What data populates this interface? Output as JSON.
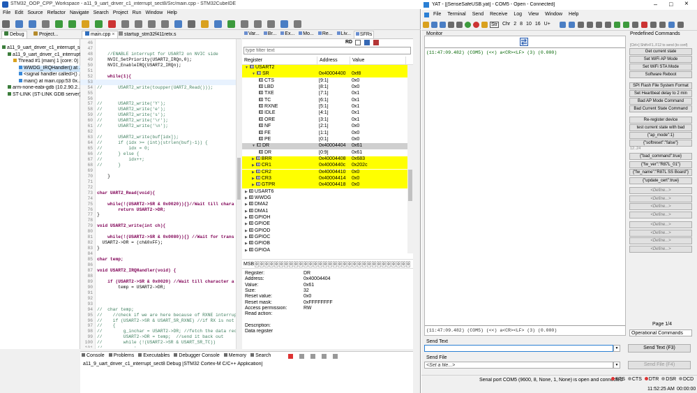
{
  "ide": {
    "title": "STM32_OOP_CPP_Workspace - a11_9_uart_driver_c1_interrupt_sect8/Src/main.cpp - STM32CubeIDE",
    "menu": [
      "File",
      "Edit",
      "Source",
      "Refactor",
      "Navigate",
      "Search",
      "Project",
      "Run",
      "Window",
      "Help"
    ],
    "debug_view": {
      "tab_debug": "Debug",
      "tab_project": "Project...",
      "tree": [
        {
          "text": "a11_9_uart_driver_c1_interrupt_sect8",
          "indent": 0
        },
        {
          "text": "a11_9_uart_driver_c1_interrupt_...",
          "indent": 1
        },
        {
          "text": "Thread #1 [main] 1 [core: 0]",
          "indent": 2
        },
        {
          "text": "WWDG_IRQHandler() at ...",
          "indent": 3
        },
        {
          "text": "<signal handler called>() ...",
          "indent": 3
        },
        {
          "text": "main() at main.cpp:53 0x...",
          "indent": 3
        },
        {
          "text": "arm-none-eabi-gdb (10.2.90.2...",
          "indent": 1
        },
        {
          "text": "ST-LINK (ST-LINK GDB server)",
          "indent": 1
        }
      ]
    },
    "editor": {
      "tab_main": "main.cpp",
      "tab_startup": "startup_stm32f411retx.s",
      "lines": [
        {
          "n": "46",
          "code": ""
        },
        {
          "n": "47",
          "code": ""
        },
        {
          "n": "48",
          "code": "    //ENABLE interrupt for USART2 on NVIC side"
        },
        {
          "n": "49",
          "code": "    NVIC_SetPriority(USART2_IRQn,0);"
        },
        {
          "n": "50",
          "code": "    NVIC_EnableIRQ(USART2_IRQn);"
        },
        {
          "n": "51",
          "code": ""
        },
        {
          "n": "52",
          "code": "    while(1){"
        },
        {
          "n": "53",
          "code": ""
        },
        {
          "n": "54",
          "code": "//      USART2_write(toupper(UART2_Read()));"
        },
        {
          "n": "55",
          "code": ""
        },
        {
          "n": "56",
          "code": ""
        },
        {
          "n": "57",
          "code": "//      USART2_write('Y');"
        },
        {
          "n": "58",
          "code": "//      USART2_write('e');"
        },
        {
          "n": "59",
          "code": "//      USART2_write('s');"
        },
        {
          "n": "60",
          "code": "//      USART2_write('\\r');"
        },
        {
          "n": "61",
          "code": "//      USART2_write('\\n');"
        },
        {
          "n": "62",
          "code": ""
        },
        {
          "n": "63",
          "code": "//      USART2_write(buf[idx]);"
        },
        {
          "n": "64",
          "code": "//      if (idx >= (int)(strlen(buf)-1)) {"
        },
        {
          "n": "65",
          "code": "//          idx = 0;"
        },
        {
          "n": "66",
          "code": "//      } else {"
        },
        {
          "n": "67",
          "code": "//          idx++;"
        },
        {
          "n": "68",
          "code": "//      }"
        },
        {
          "n": "69",
          "code": ""
        },
        {
          "n": "70",
          "code": "    }"
        },
        {
          "n": "71",
          "code": ""
        },
        {
          "n": "72",
          "code": ""
        },
        {
          "n": "73",
          "code": "char UART2_Read(void){"
        },
        {
          "n": "74",
          "code": ""
        },
        {
          "n": "75",
          "code": "    while(!(USART2->SR & 0x0020)){}//Wait till chara"
        },
        {
          "n": "76",
          "code": "        return USART2->DR;"
        },
        {
          "n": "77",
          "code": "}"
        },
        {
          "n": "78",
          "code": ""
        },
        {
          "n": "79",
          "code": "void USART2_write(int ch){"
        },
        {
          "n": "80",
          "code": ""
        },
        {
          "n": "81",
          "code": "    while(!(USART2->SR & 0x0080)){} //Wait for trans"
        },
        {
          "n": "82",
          "code": "  USART2->DR = (ch&0xFF);"
        },
        {
          "n": "83",
          "code": "}"
        },
        {
          "n": "84",
          "code": ""
        },
        {
          "n": "85",
          "code": "char temp;"
        },
        {
          "n": "86",
          "code": ""
        },
        {
          "n": "87",
          "code": "void USART2_IRQHandler(void) {"
        },
        {
          "n": "88",
          "code": ""
        },
        {
          "n": "89",
          "code": "    if (USART2->SR & 0x0020) //Wait till character a"
        },
        {
          "n": "90",
          "code": "        temp = USART2->DR;"
        },
        {
          "n": "91",
          "code": ""
        },
        {
          "n": "92",
          "code": ""
        },
        {
          "n": "93",
          "code": ""
        },
        {
          "n": "94",
          "code": "//  char temp;"
        },
        {
          "n": "95",
          "code": "//    //check if we are here because of RXNE interrup"
        },
        {
          "n": "96",
          "code": "//    if (USART2->SR & USART_SR_RXNE) //if RX is not"
        },
        {
          "n": "97",
          "code": "//    {"
        },
        {
          "n": "98",
          "code": "//        g_inchar = USART2->DR; //fetch the data rec"
        },
        {
          "n": "99",
          "code": "//        USART2->DR = temp;  //send it back out"
        },
        {
          "n": "100",
          "code": "//        while (!(USART2->SR & USART_SR_TC))"
        },
        {
          "n": "101",
          "code": "//            ;"
        },
        {
          "n": "102",
          "code": ""
        }
      ]
    },
    "sfr": {
      "tabs": [
        "Var...",
        "Br...",
        "Ex...",
        "Mo...",
        "Re...",
        "Liv...",
        "SFRs"
      ],
      "filter_placeholder": "type filter text",
      "rd_label": "RD",
      "col_register": "Register",
      "col_address": "Address",
      "col_value": "Value",
      "rows": [
        {
          "name": "USART2",
          "addr": "",
          "val": "",
          "indent": 0,
          "hl": true
        },
        {
          "name": "SR",
          "addr": "0x40004400",
          "val": "0xf8",
          "indent": 1,
          "hl": true
        },
        {
          "name": "CTS",
          "addr": "[9:1]",
          "val": "0x0",
          "indent": 2,
          "hl": false
        },
        {
          "name": "LBD",
          "addr": "[8:1]",
          "val": "0x0",
          "indent": 2,
          "hl": false
        },
        {
          "name": "TXE",
          "addr": "[7:1]",
          "val": "0x1",
          "indent": 2,
          "hl": false
        },
        {
          "name": "TC",
          "addr": "[6:1]",
          "val": "0x1",
          "indent": 2,
          "hl": false
        },
        {
          "name": "RXNE",
          "addr": "[5:1]",
          "val": "0x1",
          "indent": 2,
          "hl": false
        },
        {
          "name": "IDLE",
          "addr": "[4:1]",
          "val": "0x1",
          "indent": 2,
          "hl": false
        },
        {
          "name": "ORE",
          "addr": "[3:1]",
          "val": "0x1",
          "indent": 2,
          "hl": false
        },
        {
          "name": "NF",
          "addr": "[2:1]",
          "val": "0x0",
          "indent": 2,
          "hl": false
        },
        {
          "name": "FE",
          "addr": "[1:1]",
          "val": "0x0",
          "indent": 2,
          "hl": false
        },
        {
          "name": "PE",
          "addr": "[0:1]",
          "val": "0x0",
          "indent": 2,
          "hl": false
        },
        {
          "name": "DR",
          "addr": "0x40004404",
          "val": "0x61",
          "indent": 1,
          "hl": false,
          "sel": true
        },
        {
          "name": "DR",
          "addr": "[0:9]",
          "val": "0x61",
          "indent": 2,
          "hl": false
        },
        {
          "name": "BRR",
          "addr": "0x40004408",
          "val": "0x683",
          "indent": 1,
          "hl": true
        },
        {
          "name": "CR1",
          "addr": "0x4000440c",
          "val": "0x202c",
          "indent": 1,
          "hl": true
        },
        {
          "name": "CR2",
          "addr": "0x40004410",
          "val": "0x0",
          "indent": 1,
          "hl": true
        },
        {
          "name": "CR3",
          "addr": "0x40004414",
          "val": "0x0",
          "indent": 1,
          "hl": true
        },
        {
          "name": "GTPR",
          "addr": "0x40004418",
          "val": "0x0",
          "indent": 1,
          "hl": true
        },
        {
          "name": "USART6",
          "addr": "",
          "val": "",
          "indent": 0,
          "hl": false
        },
        {
          "name": "WWDG",
          "addr": "",
          "val": "",
          "indent": 0,
          "hl": false
        },
        {
          "name": "DMA2",
          "addr": "",
          "val": "",
          "indent": 0,
          "hl": false
        },
        {
          "name": "DMA1",
          "addr": "",
          "val": "",
          "indent": 0,
          "hl": false
        },
        {
          "name": "GPIOH",
          "addr": "",
          "val": "",
          "indent": 0,
          "hl": false
        },
        {
          "name": "GPIOE",
          "addr": "",
          "val": "",
          "indent": 0,
          "hl": false
        },
        {
          "name": "GPIOD",
          "addr": "",
          "val": "",
          "indent": 0,
          "hl": false
        },
        {
          "name": "GPIOC",
          "addr": "",
          "val": "",
          "indent": 0,
          "hl": false
        },
        {
          "name": "GPIOB",
          "addr": "",
          "val": "",
          "indent": 0,
          "hl": false
        },
        {
          "name": "GPIOA",
          "addr": "",
          "val": "",
          "indent": 0,
          "hl": false
        }
      ],
      "msb_label": "MSB",
      "bit_values": [
        "0",
        "0",
        "0",
        "0",
        "0",
        "0",
        "0",
        "0",
        "0",
        "0",
        "0",
        "0",
        "0",
        "0",
        "0",
        "0",
        "0",
        "0",
        "0",
        "0",
        "0",
        "0",
        "0",
        "0",
        "0",
        "0",
        "0",
        "0",
        "0",
        "0",
        "0",
        "0"
      ],
      "details": [
        {
          "k": "Register:",
          "v": "DR"
        },
        {
          "k": "Address:",
          "v": "0x40004404"
        },
        {
          "k": "Value:",
          "v": "0x61"
        },
        {
          "k": "Size:",
          "v": "32"
        },
        {
          "k": "Reset value:",
          "v": "0x0"
        },
        {
          "k": "Reset mask:",
          "v": "0xFFFFFFFF"
        },
        {
          "k": "Access permission:",
          "v": "RW"
        },
        {
          "k": "Read action:",
          "v": ""
        },
        {
          "k": "",
          "v": ""
        },
        {
          "k": "Description:",
          "v": ""
        },
        {
          "k": "Data register",
          "v": ""
        }
      ]
    },
    "console": {
      "tabs": [
        "Console",
        "Problems",
        "Executables",
        "Debugger Console",
        "Memory",
        "Search"
      ],
      "text": "a11_9_uart_driver_c1_interrupt_sect8 Debug [STM32 Cortex-M C/C++ Application]"
    }
  },
  "yat": {
    "title": "YAT - [[SenseSafeUSB.yat] - COM5 - Open - Connected]",
    "menu": [
      "File",
      "Terminal",
      "Send",
      "Receive",
      "Log",
      "View",
      "Window",
      "Help"
    ],
    "radix_labels": [
      "Str",
      "Chr",
      "2",
      "8",
      "10",
      "16",
      "U+"
    ],
    "monitor_label": "Monitor",
    "monitor_line": "(11:47:09.482) (COM5) (<<) a<CR><LF> (3) (0.000)",
    "monitor_bottom_line": "(11:47:09.482) (COM5) (<<) a<CR><LF> (3) (0.000)",
    "send_text_label": "Send Text",
    "send_text_button": "Send Text (F3)",
    "send_file_label": "Send File",
    "send_file_placeholder": "<Set a file...>",
    "send_file_button": "Send File (F4)",
    "predefined_label": "Predefined Commands",
    "predefined_hint": "[Ctrl+] Shift+F1..F12 to send (to conf)",
    "commands": [
      "Get current state",
      "Set WiFi AP Mode",
      "Set WiFi STA Mode",
      "Software Reboot",
      "",
      "SPI Flash File System Format",
      "Set Heartbeat delay to 2 min",
      "Bad AP Mode Command",
      "Bad Current State Command",
      "",
      "Re-register device",
      "test current state with bad",
      "{\"ap_mode\":1}",
      "{\"softreset\":\"false\"}"
    ],
    "section_label": "12..24",
    "commands2": [
      "{\"bad_command\":true}",
      "{\"fw_ver\":\"R87L_01\"}",
      "{\"fw_name\":\"R87L SS Board\"}",
      "{\"update_cert\":true}",
      "<Define...>",
      "<Define...>",
      "<Define...>",
      "<Define...>",
      "<Define...>",
      "<Define...>",
      "<Define...>",
      "<Define...>"
    ],
    "page_label": "Page 1/4",
    "operational_select": "Operational Commands",
    "status_text": "Serial port COM5 (9600, 8, None, 1, None) is open and connected",
    "indicators": [
      "RTS",
      "CTS",
      "DTR",
      "DSR",
      "DCD"
    ],
    "clock": "11:52:25 AM",
    "clock2": "00:00:00"
  }
}
